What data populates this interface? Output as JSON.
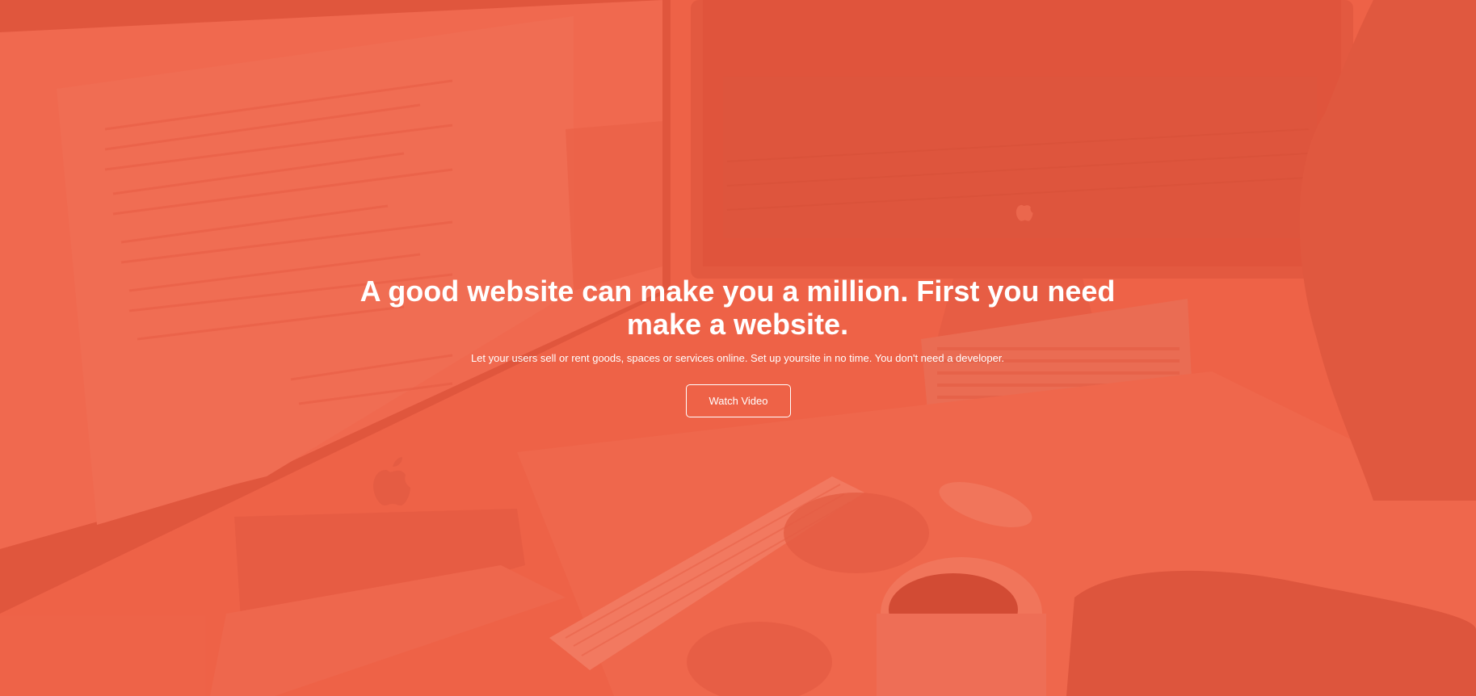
{
  "hero": {
    "headline": "A good website can make you a million. First you need make a website.",
    "subtext": "Let your users sell or rent goods, spaces or services online. Set up yoursite in no time. You don't need a developer.",
    "cta_label": "Watch Video"
  },
  "theme": {
    "overlay_color": "#ec6347",
    "text_color": "#ffffff"
  },
  "background": {
    "icons": [
      "apple-logo-icon",
      "apple-logo-icon"
    ]
  }
}
